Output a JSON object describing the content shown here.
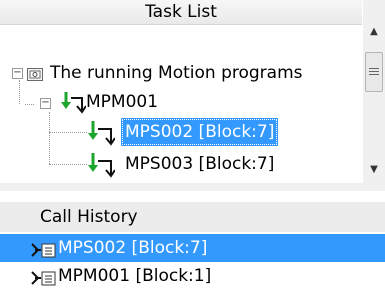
{
  "task_list": {
    "header": "Task List",
    "root": {
      "label": "The running Motion programs",
      "icon": "program-group-icon",
      "expander": "minus"
    },
    "items": [
      {
        "label": "MPM001",
        "icon": "motion-program-icon",
        "expander": "minus"
      },
      {
        "label": "MPS002 [Block:7]",
        "icon": "motion-program-icon",
        "selected": true
      },
      {
        "label": "MPS003 [Block:7]",
        "icon": "motion-program-icon"
      }
    ]
  },
  "call_history": {
    "header": "Call History",
    "items": [
      {
        "label": "MPS002 [Block:7]",
        "icon": "call-history-icon",
        "selected": true
      },
      {
        "label": "MPM001 [Block:1]",
        "icon": "call-history-icon"
      }
    ]
  },
  "colors": {
    "selection": "#3399ff",
    "arrow_green": "#1ea52b",
    "header_gray": "#ececec"
  }
}
